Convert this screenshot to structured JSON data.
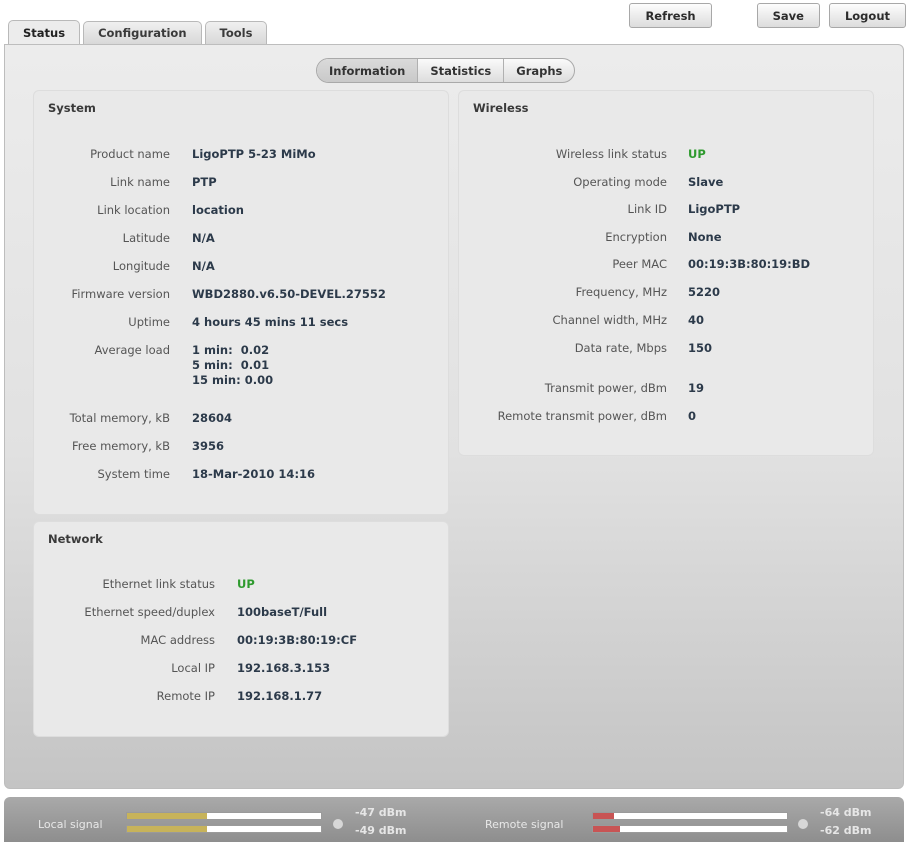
{
  "top_tabs": [
    "Status",
    "Configuration",
    "Tools"
  ],
  "top_buttons": [
    "Refresh",
    "Save",
    "Logout"
  ],
  "sub_tabs": [
    "Information",
    "Statistics",
    "Graphs"
  ],
  "system": {
    "title": "System",
    "rows": [
      {
        "label": "Product name",
        "value": "LigoPTP 5-23 MiMo"
      },
      {
        "label": "Link name",
        "value": "PTP"
      },
      {
        "label": "Link location",
        "value": "location"
      },
      {
        "label": "Latitude",
        "value": "N/A"
      },
      {
        "label": "Longitude",
        "value": "N/A"
      },
      {
        "label": "Firmware version",
        "value": "WBD2880.v6.50-DEVEL.27552"
      },
      {
        "label": "Uptime",
        "value": "4 hours 45 mins 11 secs"
      }
    ],
    "avg_load": {
      "label": "Average load",
      "values": [
        "1 min:  0.02",
        "5 min:  0.01",
        "15 min: 0.00"
      ]
    },
    "rows2": [
      {
        "label": "Total memory, kB",
        "value": "28604"
      },
      {
        "label": "Free memory, kB",
        "value": "3956"
      },
      {
        "label": "System time",
        "value": "18-Mar-2010 14:16"
      }
    ]
  },
  "network": {
    "title": "Network",
    "rows": [
      {
        "label": "Ethernet link status",
        "value": "UP"
      },
      {
        "label": "Ethernet speed/duplex",
        "value": "100baseT/Full"
      },
      {
        "label": "MAC address",
        "value": "00:19:3B:80:19:CF"
      },
      {
        "label": "Local IP",
        "value": "192.168.3.153"
      },
      {
        "label": "Remote IP",
        "value": "192.168.1.77"
      }
    ]
  },
  "wireless": {
    "title": "Wireless",
    "rows": [
      {
        "label": "Wireless link status",
        "value": "UP"
      },
      {
        "label": "Operating mode",
        "value": "Slave"
      },
      {
        "label": "Link ID",
        "value": "LigoPTP"
      },
      {
        "label": "Encryption",
        "value": "None"
      },
      {
        "label": "Peer MAC",
        "value": "00:19:3B:80:19:BD"
      },
      {
        "label": "Frequency, MHz",
        "value": "5220"
      },
      {
        "label": "Channel width, MHz",
        "value": "40"
      },
      {
        "label": "Data rate, Mbps",
        "value": "150"
      },
      {
        "label": "Transmit power, dBm",
        "value": "19"
      },
      {
        "label": "Remote transmit power, dBm",
        "value": "0"
      }
    ]
  },
  "signal": {
    "local_label": "Local signal",
    "local_dbm": [
      "-47 dBm",
      "-49 dBm"
    ],
    "local_levels": [
      0.41,
      0.41
    ],
    "local_color": "#c7b35a",
    "remote_label": "Remote signal",
    "remote_dbm": [
      "-64 dBm",
      "-62 dBm"
    ],
    "remote_levels": [
      0.11,
      0.14
    ],
    "remote_color": "#c85454",
    "up_color": "#2e9a2e"
  }
}
